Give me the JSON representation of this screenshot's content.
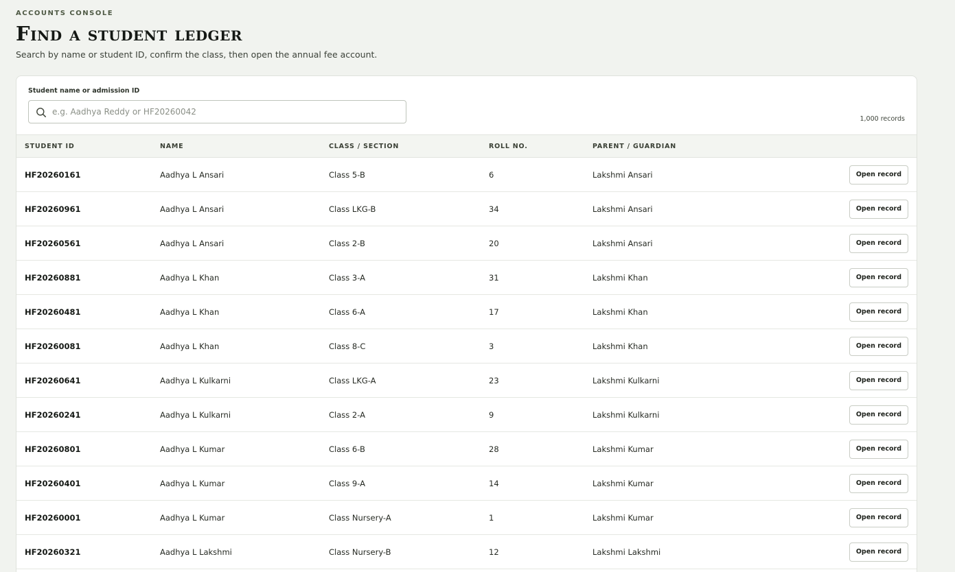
{
  "header": {
    "eyebrow": "ACCOUNTS CONSOLE",
    "title": "Find a student ledger",
    "subtitle": "Search by name or student ID, confirm the class, then open the annual fee account."
  },
  "search": {
    "label": "Student name or admission ID",
    "placeholder": "e.g. Aadhya Reddy or HF20260042",
    "value": "",
    "record_count": "1,000 records",
    "icon": "search-icon"
  },
  "table": {
    "columns": {
      "student_id": "STUDENT ID",
      "name": "NAME",
      "class_section": "CLASS / SECTION",
      "roll_no": "ROLL NO.",
      "parent": "PARENT / GUARDIAN",
      "action": ""
    },
    "action_label": "Open record",
    "rows": [
      {
        "student_id": "HF20260161",
        "name": "Aadhya L Ansari",
        "class_section": "Class 5-B",
        "roll_no": "6",
        "parent": "Lakshmi Ansari",
        "action": "Open record"
      },
      {
        "student_id": "HF20260961",
        "name": "Aadhya L Ansari",
        "class_section": "Class LKG-B",
        "roll_no": "34",
        "parent": "Lakshmi Ansari",
        "action": "Open record"
      },
      {
        "student_id": "HF20260561",
        "name": "Aadhya L Ansari",
        "class_section": "Class 2-B",
        "roll_no": "20",
        "parent": "Lakshmi Ansari",
        "action": "Open record"
      },
      {
        "student_id": "HF20260881",
        "name": "Aadhya L Khan",
        "class_section": "Class 3-A",
        "roll_no": "31",
        "parent": "Lakshmi Khan",
        "action": "Open record"
      },
      {
        "student_id": "HF20260481",
        "name": "Aadhya L Khan",
        "class_section": "Class 6-A",
        "roll_no": "17",
        "parent": "Lakshmi Khan",
        "action": "Open record"
      },
      {
        "student_id": "HF20260081",
        "name": "Aadhya L Khan",
        "class_section": "Class 8-C",
        "roll_no": "3",
        "parent": "Lakshmi Khan",
        "action": "Open record"
      },
      {
        "student_id": "HF20260641",
        "name": "Aadhya L Kulkarni",
        "class_section": "Class LKG-A",
        "roll_no": "23",
        "parent": "Lakshmi Kulkarni",
        "action": "Open record"
      },
      {
        "student_id": "HF20260241",
        "name": "Aadhya L Kulkarni",
        "class_section": "Class 2-A",
        "roll_no": "9",
        "parent": "Lakshmi Kulkarni",
        "action": "Open record"
      },
      {
        "student_id": "HF20260801",
        "name": "Aadhya L Kumar",
        "class_section": "Class 6-B",
        "roll_no": "28",
        "parent": "Lakshmi Kumar",
        "action": "Open record"
      },
      {
        "student_id": "HF20260401",
        "name": "Aadhya L Kumar",
        "class_section": "Class 9-A",
        "roll_no": "14",
        "parent": "Lakshmi Kumar",
        "action": "Open record"
      },
      {
        "student_id": "HF20260001",
        "name": "Aadhya L Kumar",
        "class_section": "Class Nursery-A",
        "roll_no": "1",
        "parent": "Lakshmi Kumar",
        "action": "Open record"
      },
      {
        "student_id": "HF20260321",
        "name": "Aadhya L Lakshmi",
        "class_section": "Class Nursery-B",
        "roll_no": "12",
        "parent": "Lakshmi Lakshmi",
        "action": "Open record"
      }
    ]
  }
}
